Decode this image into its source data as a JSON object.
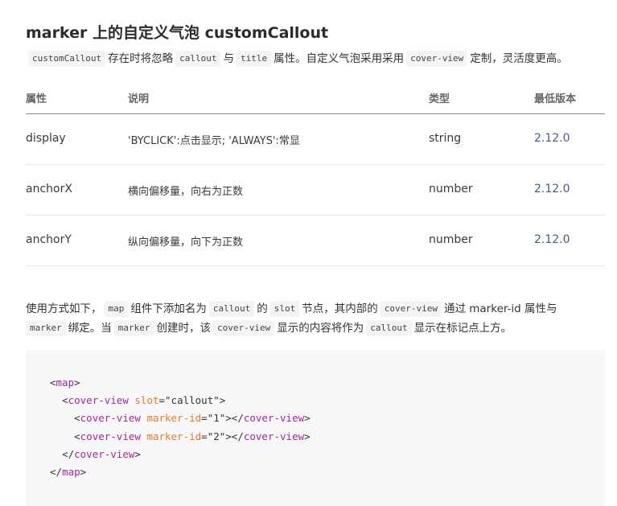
{
  "title": "marker 上的自定义气泡 customCallout",
  "desc": {
    "code1": "customCallout",
    "text1": "存在时将忽略",
    "code2": "callout",
    "text2": "与",
    "code3": "title",
    "text3": "属性。自定义气泡采用采用",
    "code4": "cover-view",
    "text4": "定制，灵活度更高。"
  },
  "table": {
    "headers": [
      "属性",
      "说明",
      "类型",
      "最低版本"
    ],
    "rows": [
      [
        "display",
        "'BYCLICK':点击显示; 'ALWAYS':常显",
        "string",
        "2.12.0"
      ],
      [
        "anchorX",
        "横向偏移量，向右为正数",
        "number",
        "2.12.0"
      ],
      [
        "anchorY",
        "纵向偏移量，向下为正数",
        "number",
        "2.12.0"
      ]
    ]
  },
  "usage": {
    "t1": "使用方式如下，",
    "c1": "map",
    "t2": "组件下添加名为",
    "c2": "callout",
    "t3": "的",
    "c3": "slot",
    "t4": "节点，其内部的",
    "c4": "cover-view",
    "t5": "通过 marker-id 属性与",
    "c5": "marker",
    "t6": "绑定。当",
    "c6": "marker",
    "t7": "创建时，该",
    "c7": "cover-view",
    "t8": "显示的内容将作为",
    "c8": "callout",
    "t9": "显示在标记点上方。"
  },
  "code": {
    "l1_open": "<",
    "l1_tag": "map",
    "l1_close": ">",
    "l2_open": "<",
    "l2_tag": "cover-view",
    "l2_attr": "slot",
    "l2_eq": "=",
    "l2_val": "\"callout\"",
    "l2_close": ">",
    "l3_open": "<",
    "l3_tag": "cover-view",
    "l3_attr": "marker-id",
    "l3_eq": "=",
    "l3_val": "\"1\"",
    "l3_mid": "></",
    "l3_tag2": "cover-view",
    "l3_close": ">",
    "l4_open": "<",
    "l4_tag": "cover-view",
    "l4_attr": "marker-id",
    "l4_eq": "=",
    "l4_val": "\"2\"",
    "l4_mid": "></",
    "l4_tag2": "cover-view",
    "l4_close": ">",
    "l5_open": "</",
    "l5_tag": "cover-view",
    "l5_close": ">",
    "l6_open": "</",
    "l6_tag": "map",
    "l6_close": ">"
  },
  "colors": {
    "tag": "#a626a4",
    "attr": "#e4792a",
    "version": "#4a5a8a",
    "code_bg": "#f8f8f8"
  }
}
